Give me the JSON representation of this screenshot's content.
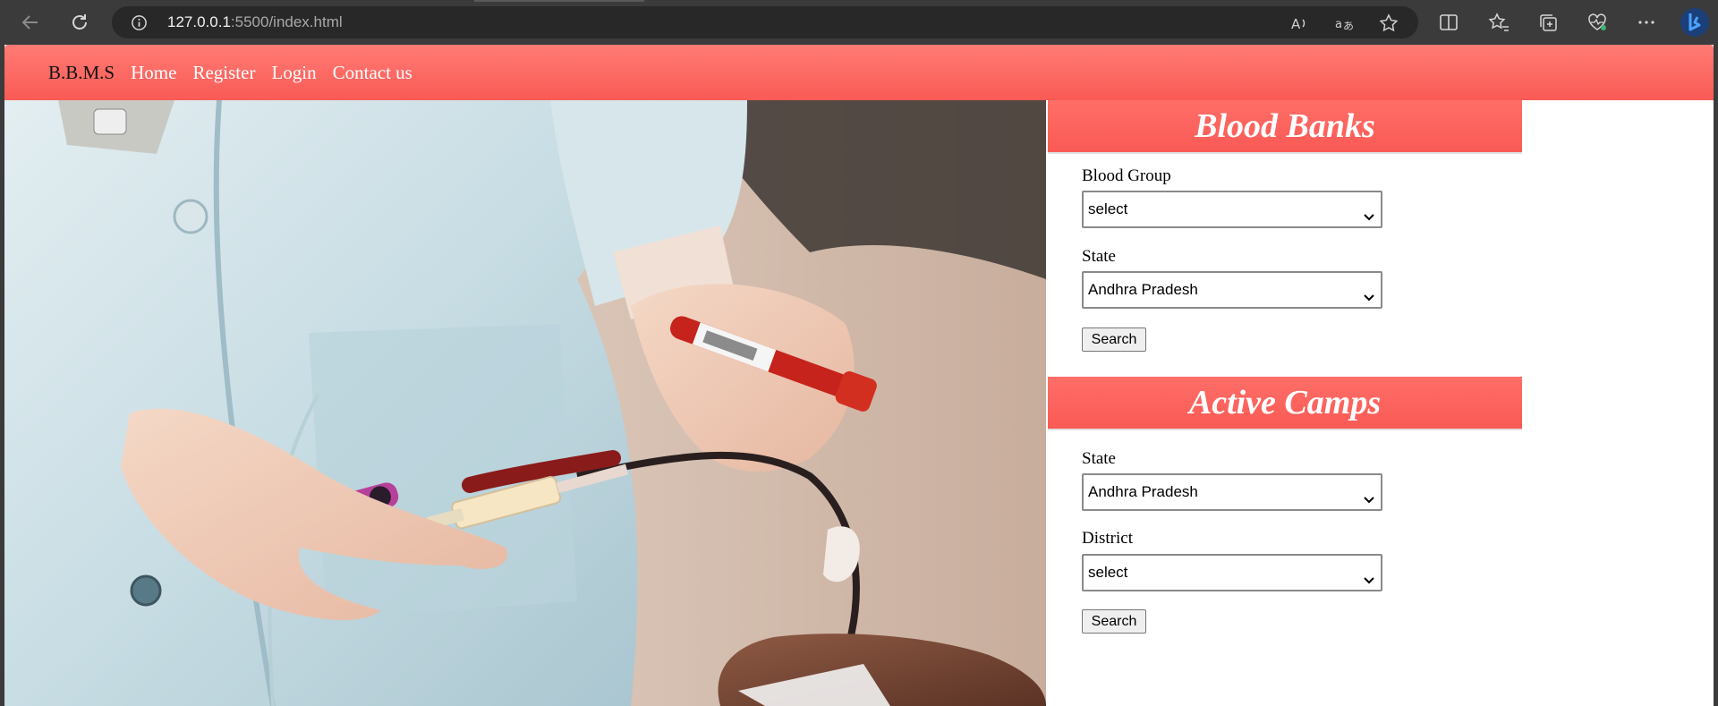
{
  "browser": {
    "url_host": "127.0.0.1",
    "url_rest": ":5500/index.html"
  },
  "navbar": {
    "brand": "B.B.M.S",
    "links": [
      "Home",
      "Register",
      "Login",
      "Contact us"
    ]
  },
  "blood_banks": {
    "title": "Blood Banks",
    "blood_group_label": "Blood Group",
    "blood_group_value": "select",
    "state_label": "State",
    "state_value": "Andhra Pradesh",
    "search_label": "Search"
  },
  "active_camps": {
    "title": "Active Camps",
    "state_label": "State",
    "state_value": "Andhra Pradesh",
    "district_label": "District",
    "district_value": "select",
    "search_label": "Search"
  },
  "colors": {
    "accent": "#fa5a55",
    "chrome_bg": "#3b3b3b"
  }
}
